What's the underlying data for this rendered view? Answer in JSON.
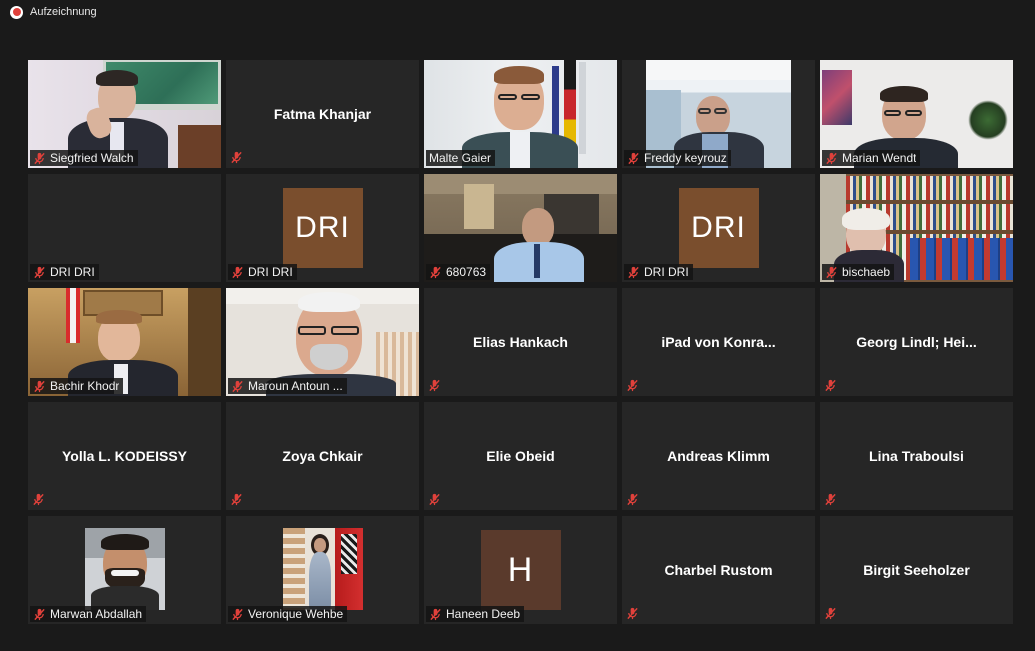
{
  "recording": {
    "label": "Aufzeichnung",
    "color": "#e0413b"
  },
  "colors": {
    "speaker_highlight": "#c7e24c",
    "tile_bg": "#262626",
    "page_bg": "#1a1a1a",
    "dri_avatar": "#7a4e2d",
    "h_avatar": "#5a3a2c"
  },
  "participants": [
    {
      "name": "Siegfried Walch",
      "muted": true,
      "kind": "video"
    },
    {
      "name": "Fatma Khanjar",
      "muted": true,
      "kind": "name"
    },
    {
      "name": "Malte Gaier",
      "muted": false,
      "kind": "video",
      "speaking": true
    },
    {
      "name": "Freddy keyrouz",
      "muted": true,
      "kind": "video"
    },
    {
      "name": "Marian Wendt",
      "muted": true,
      "kind": "video"
    },
    {
      "name": "DRI DRI",
      "muted": true,
      "kind": "empty"
    },
    {
      "name": "DRI DRI",
      "muted": true,
      "kind": "avatar",
      "avatar_text": "DRI"
    },
    {
      "name": "680763",
      "muted": true,
      "kind": "video"
    },
    {
      "name": "DRI DRI",
      "muted": true,
      "kind": "avatar",
      "avatar_text": "DRI"
    },
    {
      "name": "bischaeb",
      "muted": true,
      "kind": "video"
    },
    {
      "name": "Bachir Khodr",
      "muted": true,
      "kind": "video"
    },
    {
      "name": "Maroun Antoun ...",
      "muted": true,
      "kind": "video"
    },
    {
      "name": "Elias Hankach",
      "muted": true,
      "kind": "name"
    },
    {
      "name": "iPad von Konra...",
      "muted": true,
      "kind": "name"
    },
    {
      "name": "Georg Lindl; Hei...",
      "muted": true,
      "kind": "name"
    },
    {
      "name": "Yolla L. KODEISSY",
      "muted": true,
      "kind": "name"
    },
    {
      "name": "Zoya Chkair",
      "muted": true,
      "kind": "name"
    },
    {
      "name": "Elie Obeid",
      "muted": true,
      "kind": "name"
    },
    {
      "name": "Andreas Klimm",
      "muted": true,
      "kind": "name"
    },
    {
      "name": "Lina Traboulsi",
      "muted": true,
      "kind": "name"
    },
    {
      "name": "Marwan Abdallah",
      "muted": true,
      "kind": "photo"
    },
    {
      "name": "Veronique Wehbe",
      "muted": true,
      "kind": "photo"
    },
    {
      "name": "Haneen Deeb",
      "muted": true,
      "kind": "avatar",
      "avatar_text": "H"
    },
    {
      "name": "Charbel Rustom",
      "muted": true,
      "kind": "name"
    },
    {
      "name": "Birgit Seeholzer",
      "muted": true,
      "kind": "name"
    }
  ]
}
